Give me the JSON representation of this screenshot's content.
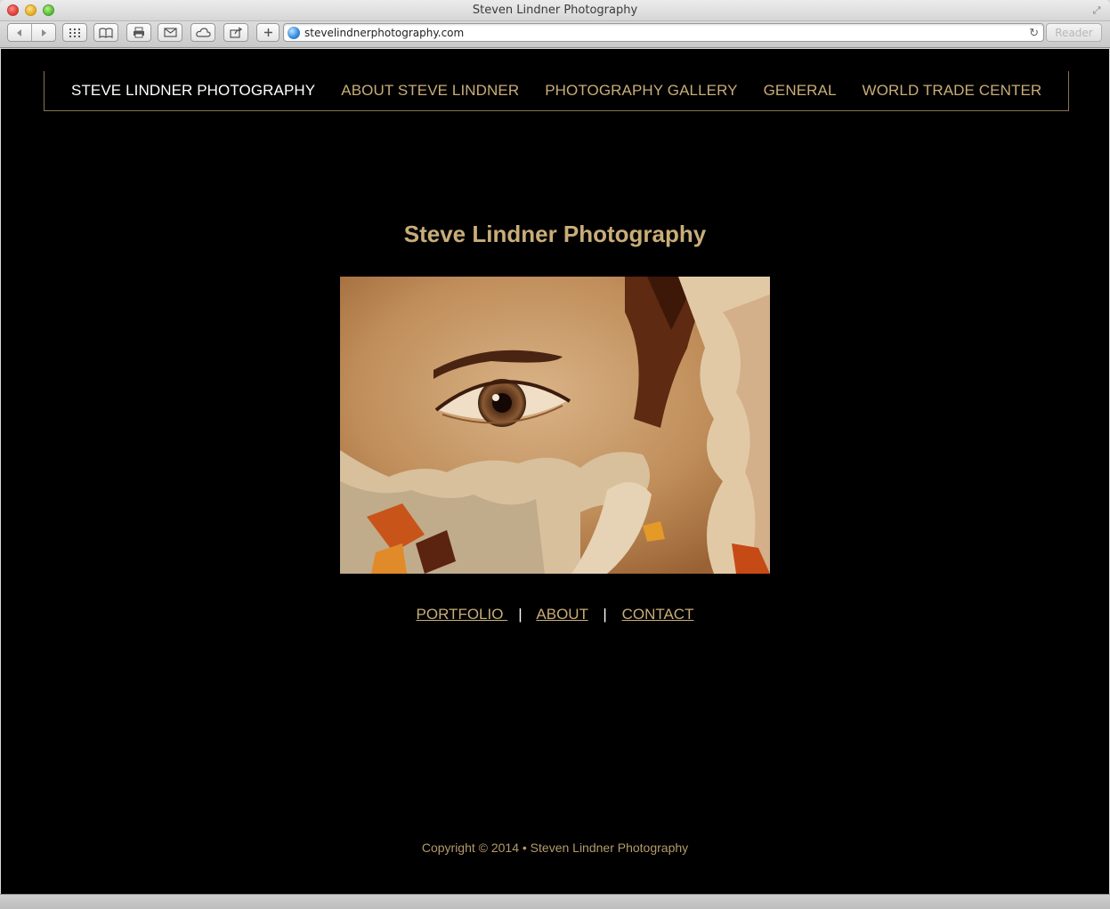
{
  "browser": {
    "window_title": "Steven Lindner Photography",
    "url": "stevelindnerphotography.com",
    "reader_label": "Reader",
    "icons": [
      "back-icon",
      "forward-icon",
      "top-sites-icon",
      "bookmarks-icon",
      "print-icon",
      "mail-icon",
      "icloud-icon",
      "share-icon",
      "add-icon",
      "globe-icon",
      "reload-icon",
      "fullscreen-icon"
    ]
  },
  "nav": {
    "items": [
      {
        "label": "STEVE LINDNER PHOTOGRAPHY",
        "active": true
      },
      {
        "label": "ABOUT STEVE LINDNER"
      },
      {
        "label": "PHOTOGRAPHY GALLERY"
      },
      {
        "label": "GENERAL"
      },
      {
        "label": "WORLD TRADE CENTER"
      }
    ]
  },
  "main": {
    "title": "Steve Lindner Photography",
    "links": [
      {
        "label": "PORTFOLIO "
      },
      {
        "label": "ABOUT"
      },
      {
        "label": "CONTACT"
      }
    ],
    "separator": "|"
  },
  "footer": {
    "copyright": "Copyright © 2014 • Steven Lindner Photography"
  },
  "colors": {
    "background": "#000000",
    "accent_gold": "#c9ad78",
    "nav_active": "#ffffff"
  }
}
